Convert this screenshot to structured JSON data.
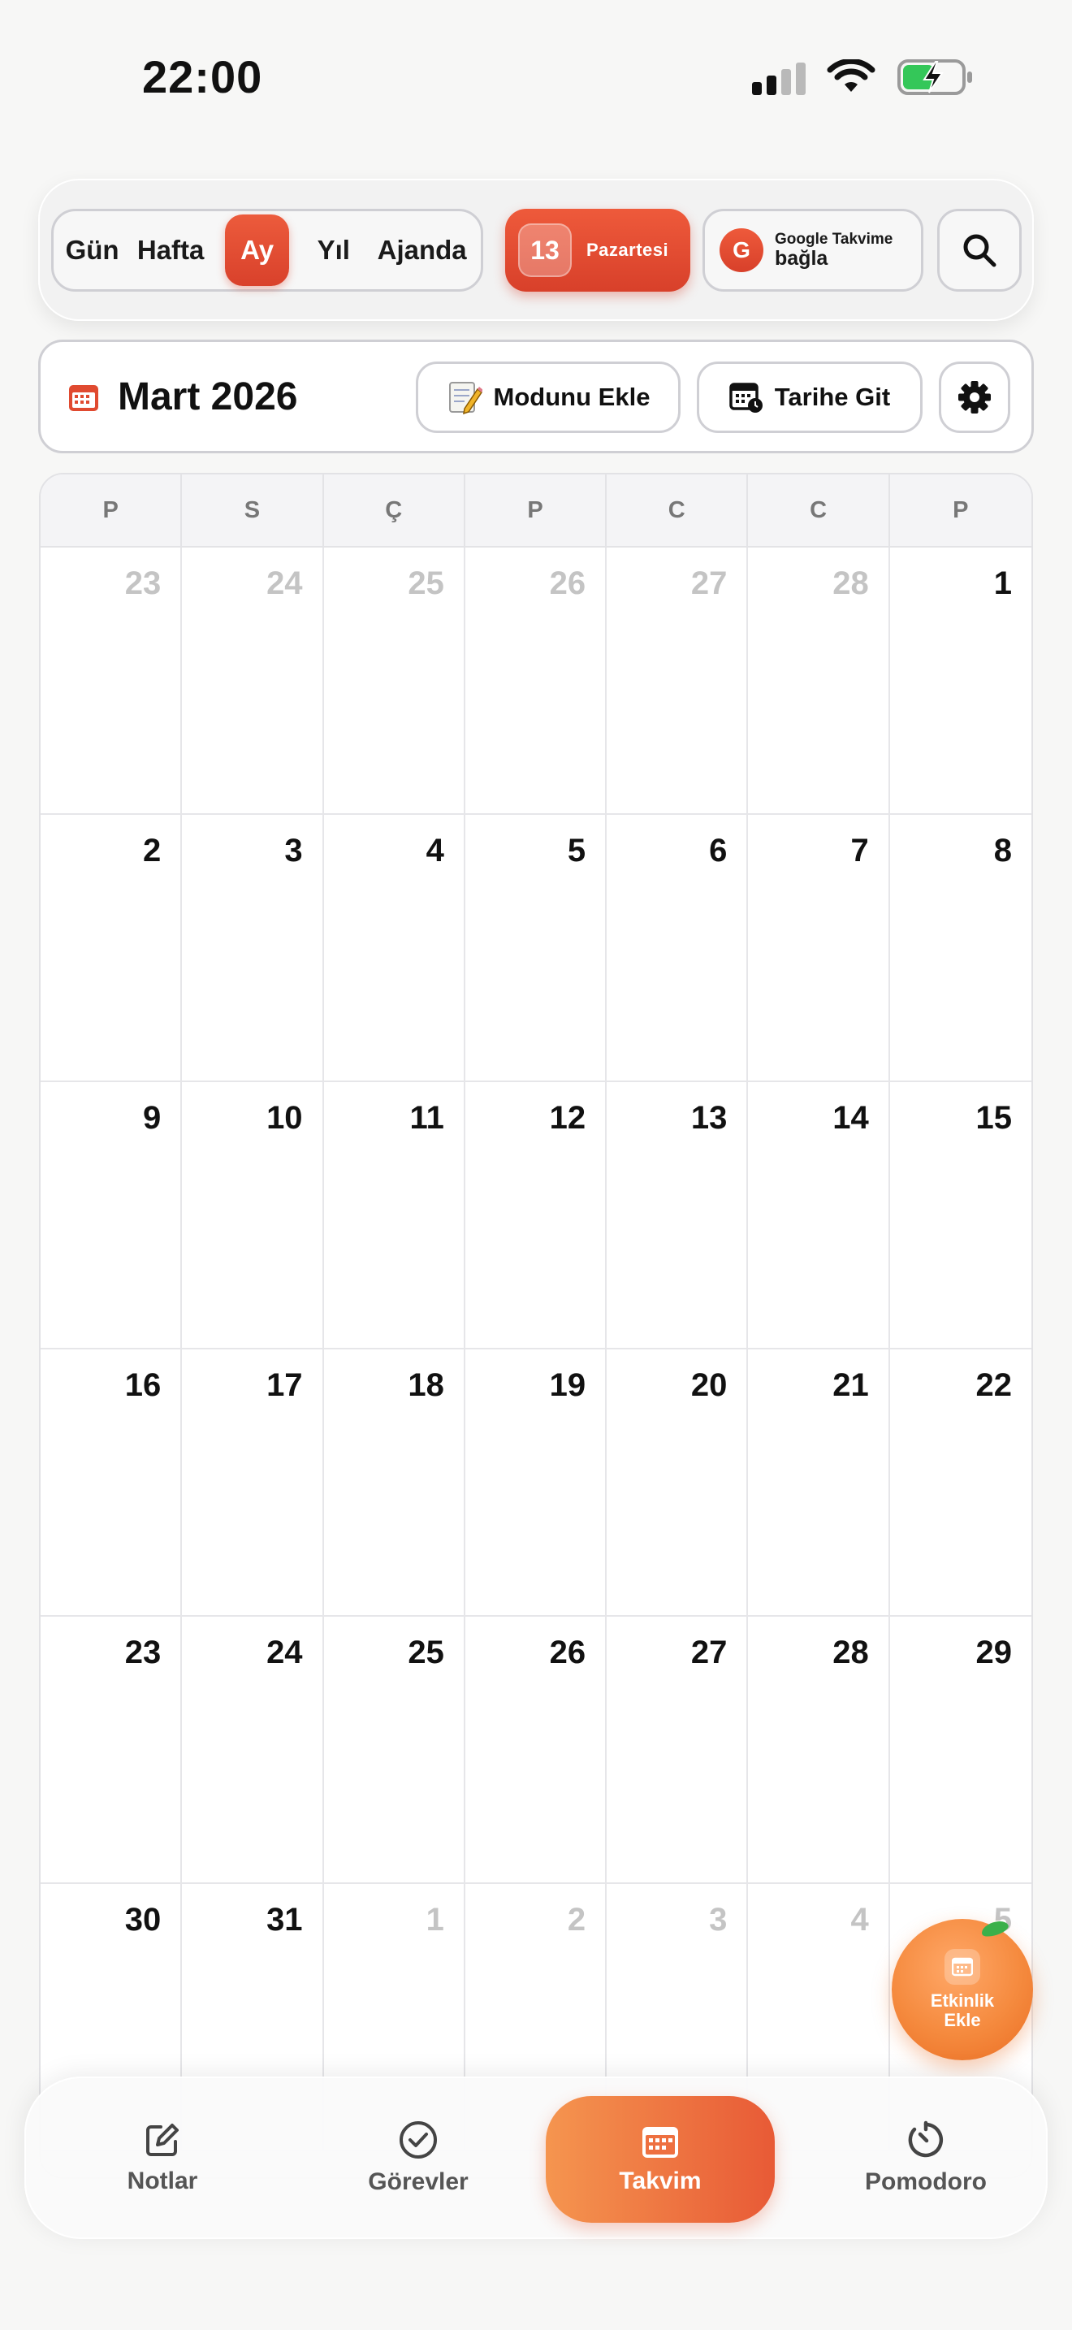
{
  "status_bar": {
    "time": "22:00"
  },
  "top_bar": {
    "views": [
      "Gün",
      "Hafta",
      "Ay",
      "Yıl",
      "Ajanda"
    ],
    "active_view": "Ay",
    "today": {
      "day_number": "13",
      "day_name": "Pazartesi"
    },
    "google": {
      "badge": "G",
      "line1": "Google Takvime",
      "line2": "bağla"
    }
  },
  "header": {
    "month_title": "Mart 2026",
    "mood_button": "Modunu Ekle",
    "goto_button": "Tarihe Git"
  },
  "calendar": {
    "weekdays": [
      "P",
      "S",
      "Ç",
      "P",
      "C",
      "C",
      "P"
    ],
    "days": [
      {
        "d": "23",
        "m": true
      },
      {
        "d": "24",
        "m": true
      },
      {
        "d": "25",
        "m": true
      },
      {
        "d": "26",
        "m": true
      },
      {
        "d": "27",
        "m": true
      },
      {
        "d": "28",
        "m": true
      },
      {
        "d": "1",
        "m": false
      },
      {
        "d": "2",
        "m": false
      },
      {
        "d": "3",
        "m": false
      },
      {
        "d": "4",
        "m": false
      },
      {
        "d": "5",
        "m": false
      },
      {
        "d": "6",
        "m": false
      },
      {
        "d": "7",
        "m": false
      },
      {
        "d": "8",
        "m": false
      },
      {
        "d": "9",
        "m": false
      },
      {
        "d": "10",
        "m": false
      },
      {
        "d": "11",
        "m": false
      },
      {
        "d": "12",
        "m": false
      },
      {
        "d": "13",
        "m": false
      },
      {
        "d": "14",
        "m": false
      },
      {
        "d": "15",
        "m": false
      },
      {
        "d": "16",
        "m": false
      },
      {
        "d": "17",
        "m": false
      },
      {
        "d": "18",
        "m": false
      },
      {
        "d": "19",
        "m": false
      },
      {
        "d": "20",
        "m": false
      },
      {
        "d": "21",
        "m": false
      },
      {
        "d": "22",
        "m": false
      },
      {
        "d": "23",
        "m": false
      },
      {
        "d": "24",
        "m": false
      },
      {
        "d": "25",
        "m": false
      },
      {
        "d": "26",
        "m": false
      },
      {
        "d": "27",
        "m": false
      },
      {
        "d": "28",
        "m": false
      },
      {
        "d": "29",
        "m": false
      },
      {
        "d": "30",
        "m": false
      },
      {
        "d": "31",
        "m": false
      },
      {
        "d": "1",
        "m": true
      },
      {
        "d": "2",
        "m": true
      },
      {
        "d": "3",
        "m": true
      },
      {
        "d": "4",
        "m": true
      },
      {
        "d": "5",
        "m": true
      }
    ]
  },
  "fab": {
    "label": "Etkinlik Ekle"
  },
  "bottom_nav": {
    "items": [
      {
        "label": "Notlar",
        "icon": "edit-icon"
      },
      {
        "label": "Görevler",
        "icon": "check-circle-icon"
      },
      {
        "label": "Takvim",
        "icon": "calendar-icon",
        "active": true
      },
      {
        "label": "Pomodoro",
        "icon": "timer-icon"
      }
    ]
  },
  "colors": {
    "accent": "#e04a30",
    "accent_orange": "#f58a3e"
  }
}
